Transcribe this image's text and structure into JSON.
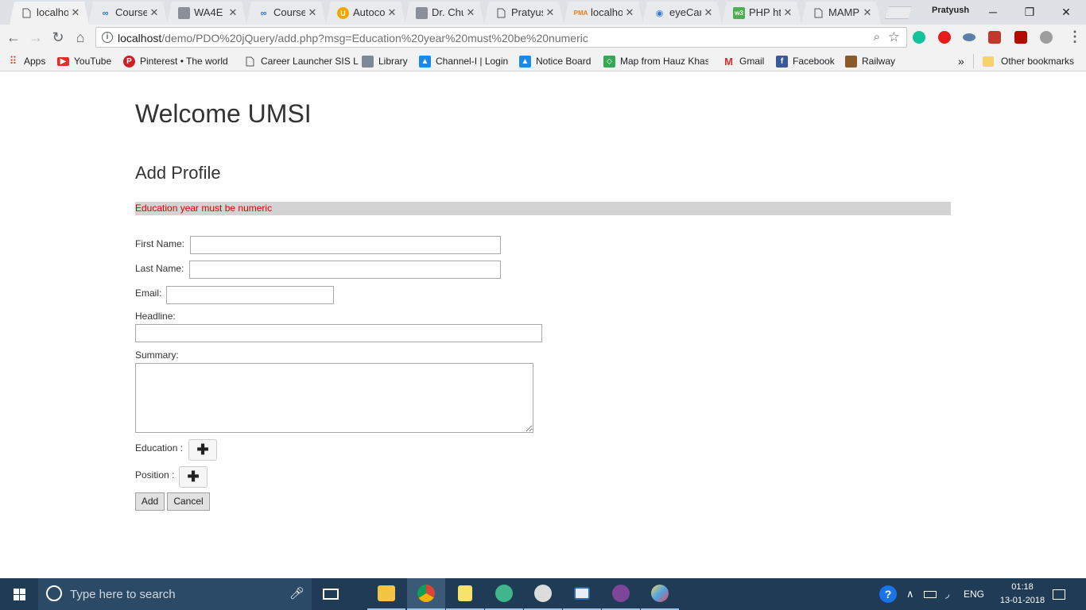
{
  "browser": {
    "tabs": [
      {
        "title": "localhost",
        "icon": "page-icon",
        "active": true
      },
      {
        "title": "Coursera",
        "icon": "coursera-icon"
      },
      {
        "title": "WA4E -",
        "icon": "avatar-icon"
      },
      {
        "title": "Coursera",
        "icon": "coursera-icon"
      },
      {
        "title": "Autocomplete",
        "icon": "autocomplete-icon"
      },
      {
        "title": "Dr. Chuck",
        "icon": "avatar-icon"
      },
      {
        "title": "Pratyush",
        "icon": "page-icon"
      },
      {
        "title": "localhost",
        "icon": "phpmyadmin-icon"
      },
      {
        "title": "eyeCare",
        "icon": "eye-icon"
      },
      {
        "title": "PHP html",
        "icon": "w3schools-icon"
      },
      {
        "title": "MAMP",
        "icon": "page-icon"
      }
    ],
    "profile_name": "Pratyush",
    "window_controls": {
      "minimize": "─",
      "restore": "❐",
      "close": "✕"
    },
    "url_host": "localhost",
    "url_path": "/demo/PDO%20jQuery/add.php?msg=Education%20year%20must%20be%20numeric",
    "bookmarks": [
      {
        "label": "Apps",
        "icon": "apps-grid-icon"
      },
      {
        "label": "YouTube",
        "icon": "youtube-icon"
      },
      {
        "label": "Pinterest • The world",
        "icon": "pinterest-icon"
      },
      {
        "label": "Career Launcher SIS L",
        "icon": "page-icon"
      },
      {
        "label": "Library",
        "icon": "library-icon"
      },
      {
        "label": "Channel-I | Login",
        "icon": "channel-icon"
      },
      {
        "label": "Notice Board",
        "icon": "channel-icon"
      },
      {
        "label": "Map from Hauz Khas",
        "icon": "maps-icon"
      },
      {
        "label": "Gmail",
        "icon": "gmail-icon"
      },
      {
        "label": "Facebook",
        "icon": "facebook-icon"
      },
      {
        "label": "Railway",
        "icon": "railway-icon"
      }
    ],
    "bookmarks_overflow": "»",
    "other_bookmarks": "Other bookmarks"
  },
  "page": {
    "title": "Welcome UMSI",
    "section_title": "Add Profile",
    "error_message": "Education year must be numeric",
    "error_color": "#e00000",
    "form": {
      "first_name_label": "First Name:",
      "first_name_value": "",
      "last_name_label": "Last Name:",
      "last_name_value": "",
      "email_label": "Email:",
      "email_value": "",
      "headline_label": "Headline:",
      "headline_value": "",
      "summary_label": "Summary:",
      "summary_value": "",
      "education_label": "Education :",
      "position_label": "Position :",
      "plus_symbol": "✚",
      "add_label": "Add",
      "cancel_label": "Cancel"
    }
  },
  "taskbar": {
    "search_placeholder": "Type here to search",
    "language": "ENG",
    "time": "01:18",
    "date": "13-01-2018",
    "accent": "#1f3b55"
  }
}
